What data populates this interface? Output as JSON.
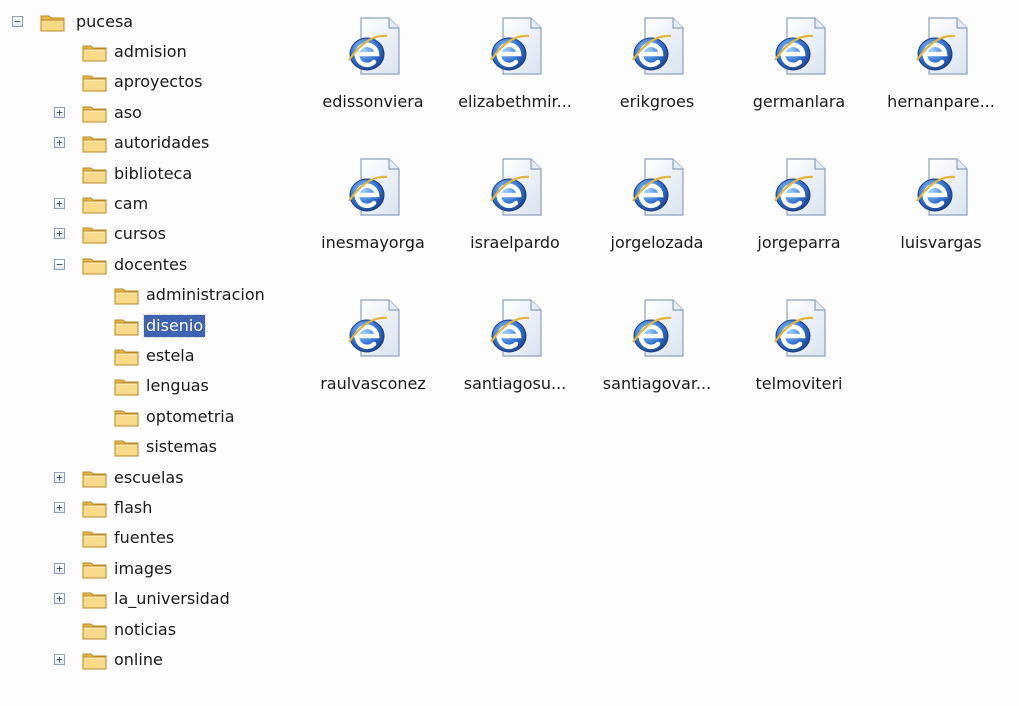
{
  "tree": {
    "root": {
      "label": "pucesa",
      "state": "expanded"
    },
    "nodes": [
      {
        "label": "admision",
        "depth": 1,
        "expander": "none"
      },
      {
        "label": "aproyectos",
        "depth": 1,
        "expander": "none"
      },
      {
        "label": "aso",
        "depth": 1,
        "expander": "collapsed"
      },
      {
        "label": "autoridades",
        "depth": 1,
        "expander": "collapsed"
      },
      {
        "label": "biblioteca",
        "depth": 1,
        "expander": "none"
      },
      {
        "label": "cam",
        "depth": 1,
        "expander": "collapsed"
      },
      {
        "label": "cursos",
        "depth": 1,
        "expander": "collapsed"
      },
      {
        "label": "docentes",
        "depth": 1,
        "expander": "expanded"
      },
      {
        "label": "administracion",
        "depth": 2,
        "expander": "none"
      },
      {
        "label": "disenio",
        "depth": 2,
        "expander": "none",
        "selected": true
      },
      {
        "label": "estela",
        "depth": 2,
        "expander": "none"
      },
      {
        "label": "lenguas",
        "depth": 2,
        "expander": "none"
      },
      {
        "label": "optometria",
        "depth": 2,
        "expander": "none"
      },
      {
        "label": "sistemas",
        "depth": 2,
        "expander": "none"
      },
      {
        "label": "escuelas",
        "depth": 1,
        "expander": "collapsed"
      },
      {
        "label": "flash",
        "depth": 1,
        "expander": "collapsed"
      },
      {
        "label": "fuentes",
        "depth": 1,
        "expander": "none"
      },
      {
        "label": "images",
        "depth": 1,
        "expander": "collapsed"
      },
      {
        "label": "la_universidad",
        "depth": 1,
        "expander": "collapsed"
      },
      {
        "label": "noticias",
        "depth": 1,
        "expander": "none"
      },
      {
        "label": "online",
        "depth": 1,
        "expander": "collapsed"
      }
    ],
    "glyphs": {
      "expanded": "−",
      "collapsed": "+"
    }
  },
  "files": [
    {
      "label": "edissonviera",
      "icon": "internet-explorer-document-icon"
    },
    {
      "label": "elizabethmir...",
      "icon": "internet-explorer-document-icon"
    },
    {
      "label": "erikgroes",
      "icon": "internet-explorer-document-icon"
    },
    {
      "label": "germanlara",
      "icon": "internet-explorer-document-icon"
    },
    {
      "label": "hernanpare...",
      "icon": "internet-explorer-document-icon"
    },
    {
      "label": "inesmayorga",
      "icon": "internet-explorer-document-icon"
    },
    {
      "label": "israelpardo",
      "icon": "internet-explorer-document-icon"
    },
    {
      "label": "jorgelozada",
      "icon": "internet-explorer-document-icon"
    },
    {
      "label": "jorgeparra",
      "icon": "internet-explorer-document-icon"
    },
    {
      "label": "luisvargas",
      "icon": "internet-explorer-document-icon"
    },
    {
      "label": "raulvasconez",
      "icon": "internet-explorer-document-icon"
    },
    {
      "label": "santiagosu...",
      "icon": "internet-explorer-document-icon"
    },
    {
      "label": "santiagovar...",
      "icon": "internet-explorer-document-icon"
    },
    {
      "label": "telmoviteri",
      "icon": "internet-explorer-document-icon"
    }
  ],
  "colors": {
    "selection": "#3f63b3",
    "folder": "#f3d27a",
    "ie_blue": "#2f6fd1"
  }
}
